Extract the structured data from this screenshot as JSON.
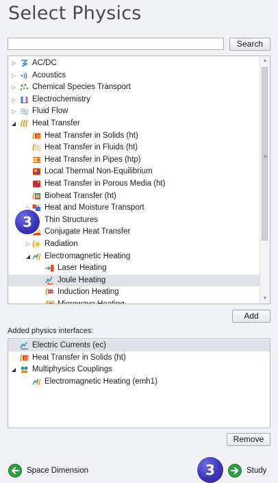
{
  "title": "Select Physics",
  "search": {
    "value": "",
    "button": "Search"
  },
  "tree": [
    {
      "label": "AC/DC",
      "icon": "acdc-icon",
      "arrow": "collapsed"
    },
    {
      "label": "Acoustics",
      "icon": "acoustics-icon",
      "arrow": "collapsed"
    },
    {
      "label": "Chemical Species Transport",
      "icon": "chemical-species-icon",
      "arrow": "collapsed"
    },
    {
      "label": "Electrochemistry",
      "icon": "electrochemistry-icon",
      "arrow": "collapsed"
    },
    {
      "label": "Fluid Flow",
      "icon": "fluid-flow-icon",
      "arrow": "collapsed"
    },
    {
      "label": "Heat Transfer",
      "icon": "heat-transfer-icon",
      "arrow": "expanded"
    },
    {
      "label": "Heat Transfer in Solids (ht)",
      "icon": "heat-solids-icon",
      "arrow": "none"
    },
    {
      "label": "Heat Transfer in Fluids (ht)",
      "icon": "heat-fluids-icon",
      "arrow": "none"
    },
    {
      "label": "Heat Transfer in Pipes (htp)",
      "icon": "heat-pipes-icon",
      "arrow": "none"
    },
    {
      "label": "Local Thermal Non-Equilibrium",
      "icon": "thermal-nonequilibrium-icon",
      "arrow": "none"
    },
    {
      "label": "Heat Transfer in Porous Media (ht)",
      "icon": "porous-media-icon",
      "arrow": "none"
    },
    {
      "label": "Bioheat Transfer (ht)",
      "icon": "bioheat-icon",
      "arrow": "none"
    },
    {
      "label": "Heat and Moisture Transport",
      "icon": "heat-moisture-icon",
      "arrow": "collapsed"
    },
    {
      "label": "Thin Structures",
      "icon": "thin-structures-icon",
      "arrow": "collapsed"
    },
    {
      "label": "Conjugate Heat Transfer",
      "icon": "conjugate-heat-icon",
      "arrow": "collapsed"
    },
    {
      "label": "Radiation",
      "icon": "radiation-icon",
      "arrow": "collapsed"
    },
    {
      "label": "Electromagnetic Heating",
      "icon": "em-heating-icon",
      "arrow": "expanded"
    },
    {
      "label": "Laser Heating",
      "icon": "laser-heating-icon",
      "arrow": "none"
    },
    {
      "label": "Joule Heating",
      "icon": "joule-heating-icon",
      "arrow": "none",
      "selected": true
    },
    {
      "label": "Induction Heating",
      "icon": "induction-heating-icon",
      "arrow": "none"
    },
    {
      "label": "Microwave Heating",
      "icon": "microwave-heating-icon",
      "arrow": "none"
    }
  ],
  "add_button": "Add",
  "added_label": "Added physics interfaces:",
  "added": [
    {
      "label": "Electric Currents (ec)",
      "icon": "electric-currents-icon",
      "arrow": "none",
      "selected": true
    },
    {
      "label": "Heat Transfer in Solids (ht)",
      "icon": "heat-solids-icon",
      "arrow": "none"
    },
    {
      "label": "Multiphysics Couplings",
      "icon": "multiphysics-icon",
      "arrow": "expanded"
    },
    {
      "label": "Electromagnetic Heating (emh1)",
      "icon": "em-heating-icon",
      "arrow": "none"
    }
  ],
  "remove_button": "Remove",
  "nav": {
    "back": "Space Dimension",
    "next": "Study"
  },
  "step_badges": [
    "3",
    "3"
  ],
  "colors": {
    "accent": "#2f9e44",
    "badge": "#3b36b8",
    "selection": "#dfe3e8"
  }
}
